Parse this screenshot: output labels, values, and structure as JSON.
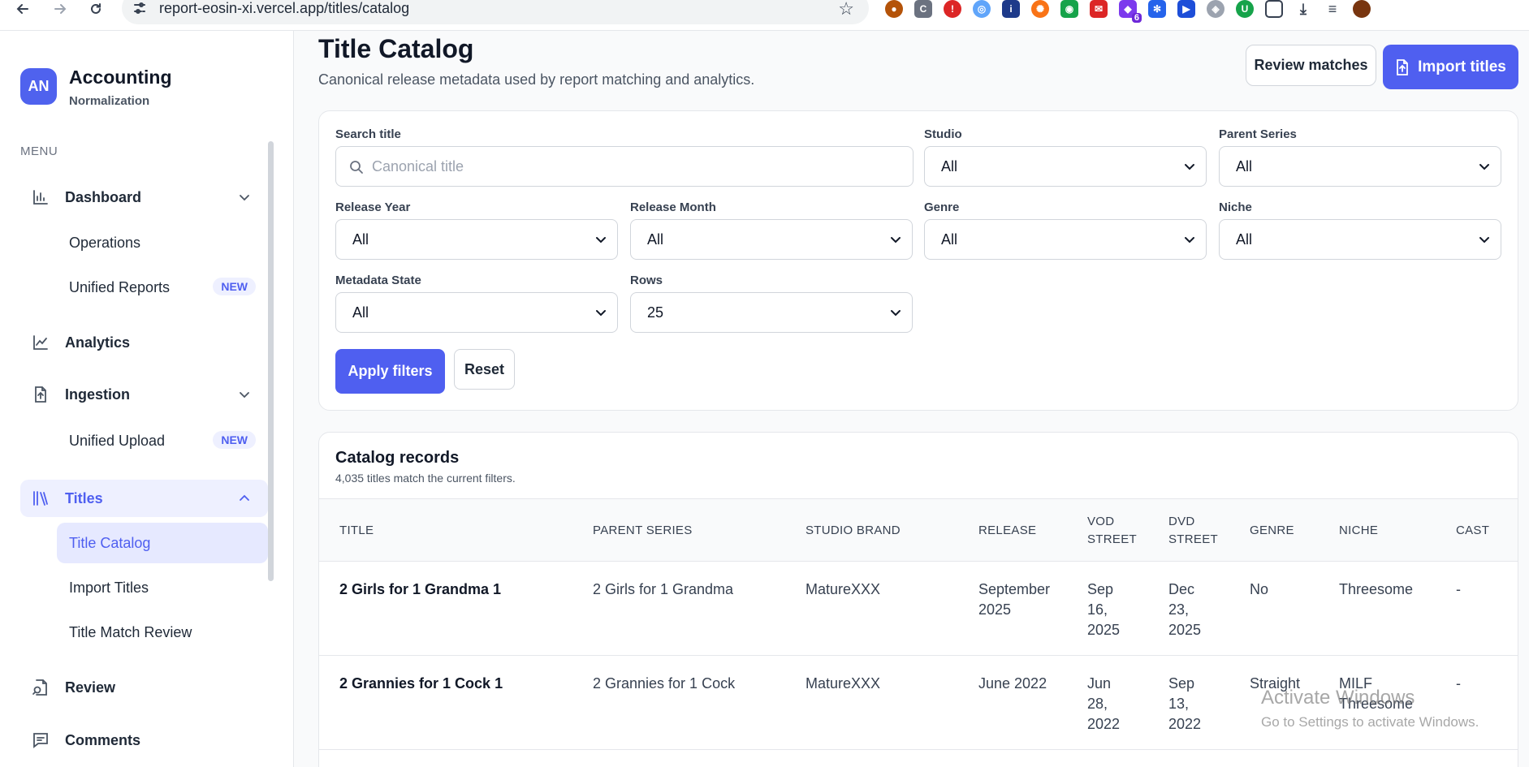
{
  "browser": {
    "url": "report-eosin-xi.vercel.app/titles/catalog",
    "extension_badge": "6"
  },
  "sidebar": {
    "avatar": "AN",
    "app_title": "Accounting",
    "app_subtitle": "Normalization",
    "menu_label": "MENU",
    "items": {
      "dashboard": "Dashboard",
      "operations": "Operations",
      "unified_reports": "Unified Reports",
      "analytics": "Analytics",
      "ingestion": "Ingestion",
      "unified_upload": "Unified Upload",
      "titles": "Titles",
      "title_catalog": "Title Catalog",
      "import_titles": "Import Titles",
      "title_match_review": "Title Match Review",
      "review": "Review",
      "comments": "Comments"
    },
    "new_badge": "NEW"
  },
  "header": {
    "title": "Title Catalog",
    "subtitle": "Canonical release metadata used by report matching and analytics.",
    "review_button": "Review matches",
    "import_button": "Import titles"
  },
  "filters": {
    "search_label": "Search title",
    "search_placeholder": "Canonical title",
    "studio_label": "Studio",
    "studio_value": "All",
    "parent_series_label": "Parent Series",
    "parent_series_value": "All",
    "release_year_label": "Release Year",
    "release_year_value": "All",
    "release_month_label": "Release Month",
    "release_month_value": "All",
    "genre_label": "Genre",
    "genre_value": "All",
    "niche_label": "Niche",
    "niche_value": "All",
    "metadata_state_label": "Metadata State",
    "metadata_state_value": "All",
    "rows_label": "Rows",
    "rows_value": "25",
    "apply_button": "Apply filters",
    "reset_button": "Reset"
  },
  "records": {
    "title": "Catalog records",
    "count_text": "4,035 titles match the current filters.",
    "columns": {
      "title": "TITLE",
      "parent_series": "PARENT SERIES",
      "studio_brand": "STUDIO BRAND",
      "release": "RELEASE",
      "vod_street_1": "VOD",
      "vod_street_2": "STREET",
      "dvd_street_1": "DVD",
      "dvd_street_2": "STREET",
      "genre": "GENRE",
      "niche": "NICHE",
      "cast": "CAST"
    },
    "rows": [
      {
        "title": "2 Girls for 1 Grandma 1",
        "parent_series": "2 Girls for 1 Grandma",
        "studio_brand": "MatureXXX",
        "release_1": "September",
        "release_2": "2025",
        "vod_1": "Sep",
        "vod_2": "16,",
        "vod_3": "2025",
        "dvd_1": "Dec",
        "dvd_2": "23,",
        "dvd_3": "2025",
        "genre": "No",
        "niche": "Threesome",
        "cast": "-"
      },
      {
        "title": "2 Grannies for 1 Cock 1",
        "parent_series": "2 Grannies for 1 Cock",
        "studio_brand": "MatureXXX",
        "release_1": "June 2022",
        "release_2": "",
        "vod_1": "Jun",
        "vod_2": "28,",
        "vod_3": "2022",
        "dvd_1": "Sep",
        "dvd_2": "13,",
        "dvd_3": "2022",
        "genre": "Straight",
        "niche": "MILF",
        "niche_2": "Threesome",
        "cast": "-"
      }
    ]
  },
  "watermark": {
    "line1": "Activate Windows",
    "line2": "Go to Settings to activate Windows."
  },
  "colors": {
    "accent": "#4f5ff0",
    "accent_light": "#eef0ff"
  }
}
